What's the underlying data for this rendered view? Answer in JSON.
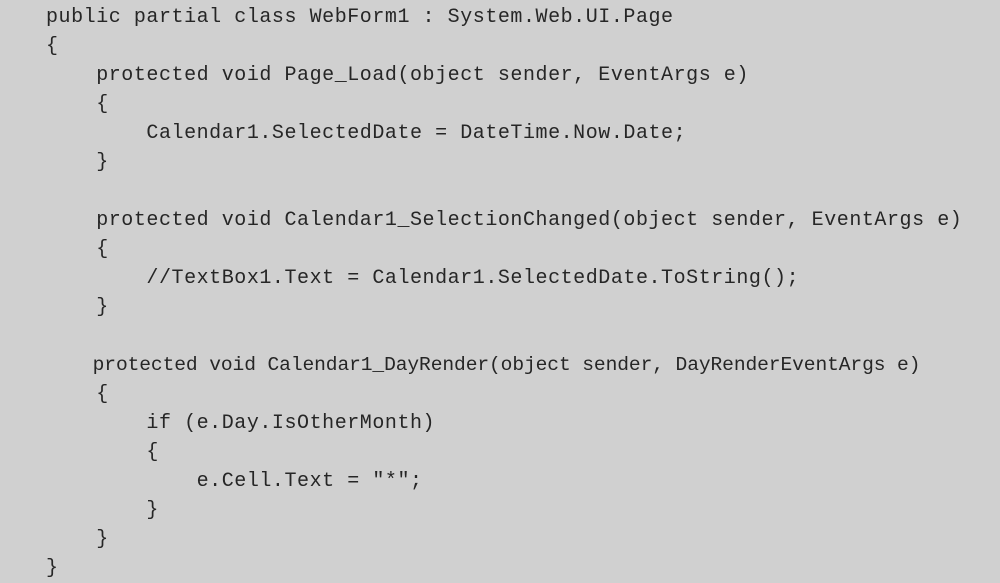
{
  "document": {
    "kind": "source-code-listing",
    "language": "C#",
    "background_color": "#d0d0d0",
    "text_color": "#262626",
    "font_style": "monospace",
    "lines": [
      {
        "n": 1,
        "text": "public partial class WebForm1 : System.Web.UI.Page",
        "indent": 0,
        "condensed": false
      },
      {
        "n": 2,
        "text": "{",
        "indent": 0,
        "condensed": false
      },
      {
        "n": 3,
        "text": "protected void Page_Load(object sender, EventArgs e)",
        "indent": 1,
        "condensed": false
      },
      {
        "n": 4,
        "text": "{",
        "indent": 1,
        "condensed": false
      },
      {
        "n": 5,
        "text": "Calendar1.SelectedDate = DateTime.Now.Date;",
        "indent": 2,
        "condensed": false
      },
      {
        "n": 6,
        "text": "}",
        "indent": 1,
        "condensed": false
      },
      {
        "n": 7,
        "text": "",
        "indent": 0,
        "condensed": false
      },
      {
        "n": 8,
        "text": "protected void Calendar1_SelectionChanged(object sender, EventArgs e)",
        "indent": 1,
        "condensed": false
      },
      {
        "n": 9,
        "text": "{",
        "indent": 1,
        "condensed": false
      },
      {
        "n": 10,
        "text": "//TextBox1.Text = Calendar1.SelectedDate.ToString();",
        "indent": 2,
        "condensed": false
      },
      {
        "n": 11,
        "text": "}",
        "indent": 1,
        "condensed": false
      },
      {
        "n": 12,
        "text": "",
        "indent": 0,
        "condensed": false
      },
      {
        "n": 13,
        "text": "protected void Calendar1_DayRender(object sender, DayRenderEventArgs e)",
        "indent": 1,
        "condensed": true
      },
      {
        "n": 14,
        "text": "{",
        "indent": 1,
        "condensed": false
      },
      {
        "n": 15,
        "text": "if (e.Day.IsOtherMonth)",
        "indent": 2,
        "condensed": false
      },
      {
        "n": 16,
        "text": "{",
        "indent": 2,
        "condensed": false
      },
      {
        "n": 17,
        "text": "e.Cell.Text = \"*\";",
        "indent": 3,
        "condensed": false
      },
      {
        "n": 18,
        "text": "}",
        "indent": 2,
        "condensed": false
      },
      {
        "n": 19,
        "text": "}",
        "indent": 1,
        "condensed": false
      },
      {
        "n": 20,
        "text": "}",
        "indent": 0,
        "condensed": false
      }
    ]
  }
}
